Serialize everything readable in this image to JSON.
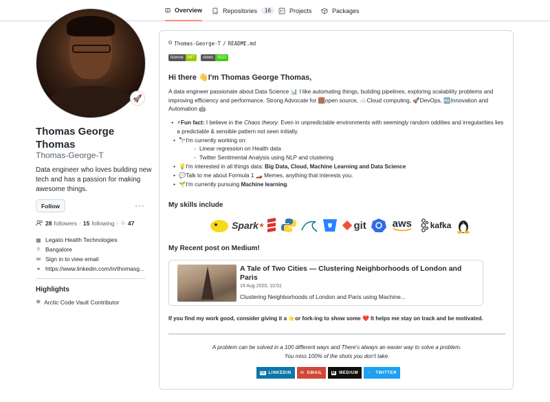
{
  "tabs": [
    {
      "label": "Overview",
      "icon": "book-icon",
      "active": true
    },
    {
      "label": "Repositories",
      "icon": "repo-icon",
      "count": "16"
    },
    {
      "label": "Projects",
      "icon": "project-icon"
    },
    {
      "label": "Packages",
      "icon": "package-icon"
    }
  ],
  "profile": {
    "name": "Thomas George Thomas",
    "username": "Thomas-George-T",
    "status_emoji": "🚀",
    "bio": "Data engineer who loves building new tech and has a passion for making awesome things.",
    "follow_label": "Follow",
    "more_label": "···",
    "followers_count": "28",
    "followers_label": "followers",
    "following_count": "15",
    "following_label": "following",
    "stars_count": "47",
    "company": "Legato Health Technologies",
    "location": "Bangalore",
    "email": "Sign in to view email",
    "website": "https://www.linkedin.com/in/thomasg..."
  },
  "highlights": {
    "title": "Highlights",
    "items": [
      "Arctic Code Vault Contributor"
    ]
  },
  "readme": {
    "owner": "Thomas-George-T",
    "separator": "/",
    "file": "README.md",
    "badges": [
      {
        "key": "license",
        "value": "MIT",
        "color": "#97ca00"
      },
      {
        "key": "views",
        "value": "5522",
        "color": "#4c1"
      }
    ],
    "heading": "Hi there 👋I'm Thomas George Thomas,",
    "intro": "A data engineer passionate about Data Science 📊 I like automating things, building pipelines, exploring scalability problems and improving efficiency and performance. Strong Advocate for 🟫open source, ☁️Cloud computing, 🚀DevOps, 🆕Innovation and Automation 🤖",
    "bullets": [
      {
        "prefix": "⚡",
        "strong": "Fun fact:",
        "text": " I believe in the ",
        "em": "Chaos theory",
        "rest": ": Even in unpredictable environments with seemingly random oddities and irregularities lies a predictable & sensible pattern not seen initially."
      },
      {
        "prefix": "🔭",
        "text": "I'm currently working on:"
      },
      {
        "prefix": "💡",
        "text": "I'm interested in all things data: ",
        "strong": "Big Data, Cloud, Machine Learning and Data Science"
      },
      {
        "prefix": "💬",
        "text": "Talk to me about Formula 1 🏎️ Memes, anything that interests you."
      },
      {
        "prefix": "🌱",
        "text": "I'm currently pursuing ",
        "strong": "Machine learning",
        "rest": "."
      }
    ],
    "sub_bullets": [
      "Linear regression on Health data",
      "Twitter Sentimental Analysis using NLP and clustering"
    ],
    "skills_heading": "My skills include",
    "skills": [
      "hadoop",
      "Spark",
      "scala",
      "python",
      "mysql",
      "bitbucket",
      "git",
      "kubernetes",
      "aws",
      "kafka",
      "linux"
    ],
    "medium_heading": "My Recent post on Medium!",
    "post": {
      "title": "A Tale of Two Cities — Clustering Neighborhoods of London and Paris",
      "date": "19 Aug 2020, 10:51",
      "desc": "Clustering Neighborhoods of London and Paris using Machine..."
    },
    "star_line": "If you find my work good, consider giving it a ⭐or fork-ing to show some ❤️ It helps me stay on track and be motivated.",
    "quote_1": "A problem can be solved in a 100 different ways and There's always an easier way to solve a problem.",
    "quote_2": "You miss 100% of the shots you don't take.",
    "socials": [
      {
        "label": "LINKEDIN",
        "icon": "linkedin-icon",
        "color": "#0e76a8"
      },
      {
        "label": "GMAIL",
        "icon": "gmail-icon",
        "color": "#d14836"
      },
      {
        "label": "MEDIUM",
        "icon": "medium-icon",
        "color": "#12100e"
      },
      {
        "label": "TWITTER",
        "icon": "twitter-icon",
        "color": "#1ca0f2"
      }
    ]
  }
}
